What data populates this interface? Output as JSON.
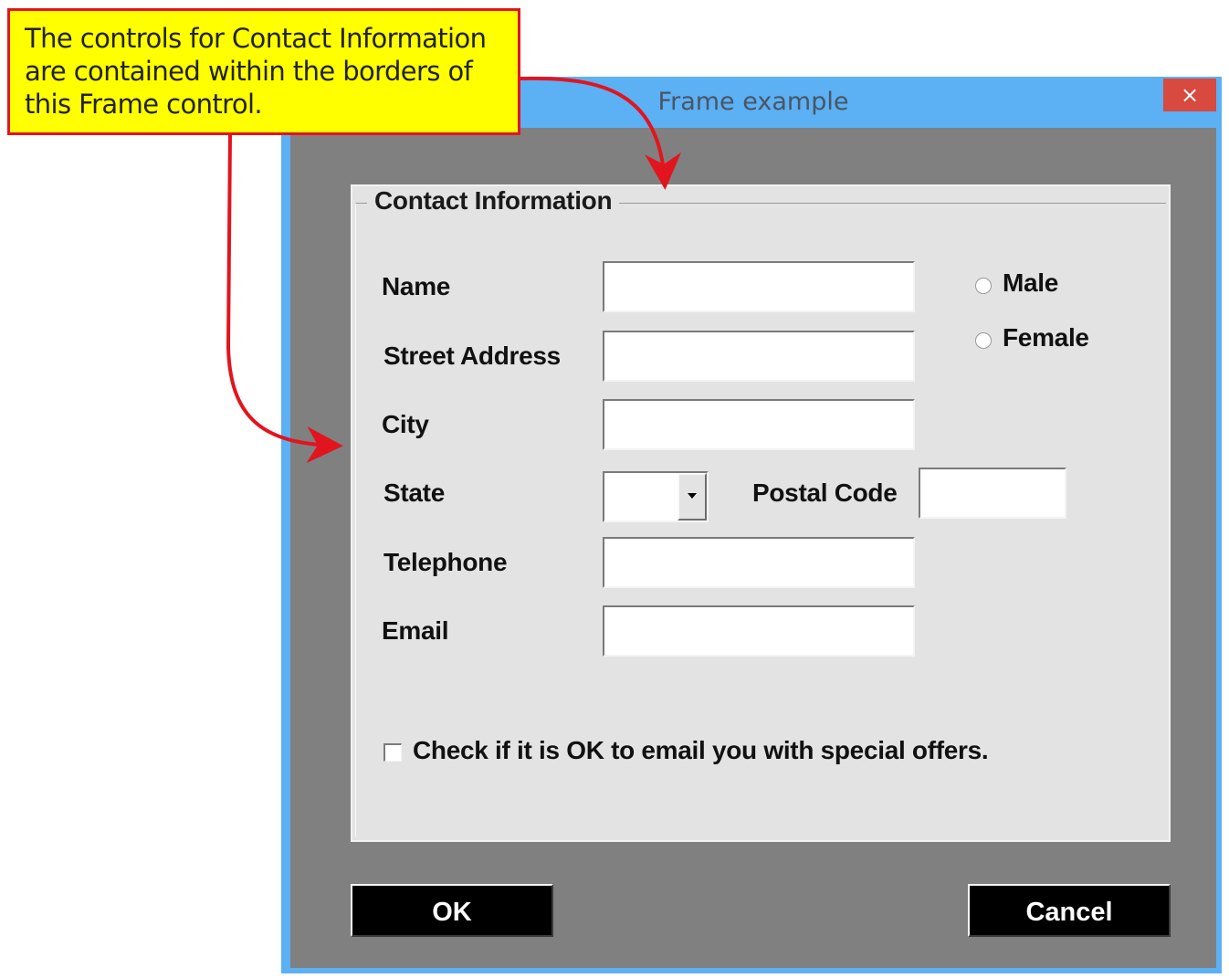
{
  "window": {
    "title": "Frame example",
    "close_glyph": "×"
  },
  "frame": {
    "caption": "Contact Information"
  },
  "fields": {
    "name_label": "Name",
    "street_label": "Street Address",
    "city_label": "City",
    "state_label": "State",
    "postal_label": "Postal Code",
    "telephone_label": "Telephone",
    "email_label": "Email",
    "name_value": "",
    "street_value": "",
    "city_value": "",
    "state_value": "",
    "postal_value": "",
    "telephone_value": "",
    "email_value": ""
  },
  "gender": {
    "male_label": "Male",
    "female_label": "Female"
  },
  "offers": {
    "label": "Check if it is OK to email you with special offers.",
    "checked": false
  },
  "buttons": {
    "ok_label": "OK",
    "cancel_label": "Cancel"
  },
  "callout": {
    "text": "The controls for Contact Information\nare contained within the borders of\nthis Frame control."
  },
  "colors": {
    "title_bar": "#5cb0f4",
    "client_bg": "#808080",
    "frame_bg": "#e3e3e3",
    "close_button": "#d8493f",
    "callout_fill": "#ffff00",
    "callout_border": "#e2141e",
    "arrow": "#e2141e"
  },
  "icons": {
    "close": "close-icon",
    "dropdown": "chevron-down-icon"
  }
}
